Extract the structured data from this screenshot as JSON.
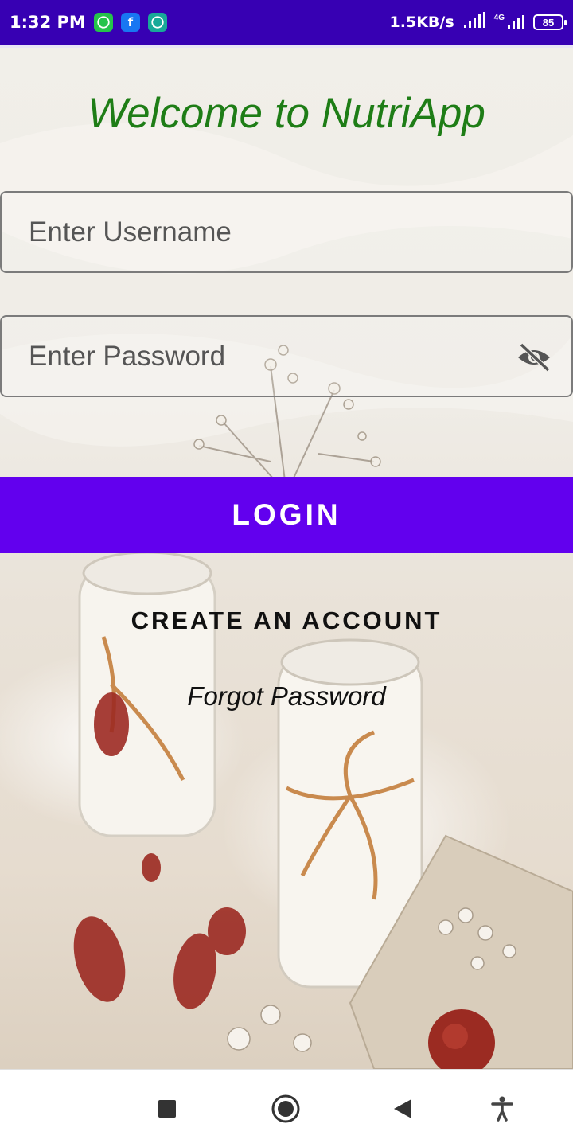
{
  "status_bar": {
    "time": "1:32 PM",
    "app_icons": [
      "whatsapp-icon",
      "facebook-icon",
      "whatsapp-business-icon"
    ],
    "net_speed": "1.5KB/s",
    "network_type": "4G",
    "battery": "85"
  },
  "login_screen": {
    "title": "Welcome to NutriApp",
    "username_placeholder": "Enter Username",
    "password_placeholder": "Enter Password",
    "login_label": "LOGIN",
    "create_account_label": "CREATE AN ACCOUNT",
    "forgot_password_label": "Forgot Password"
  },
  "colors": {
    "status_bar": "#3700b3",
    "title_green": "#1e7d16",
    "login_button": "#6200ee"
  },
  "nav_bar": {
    "buttons": [
      "recents-icon",
      "home-icon",
      "back-icon",
      "accessibility-icon"
    ]
  }
}
